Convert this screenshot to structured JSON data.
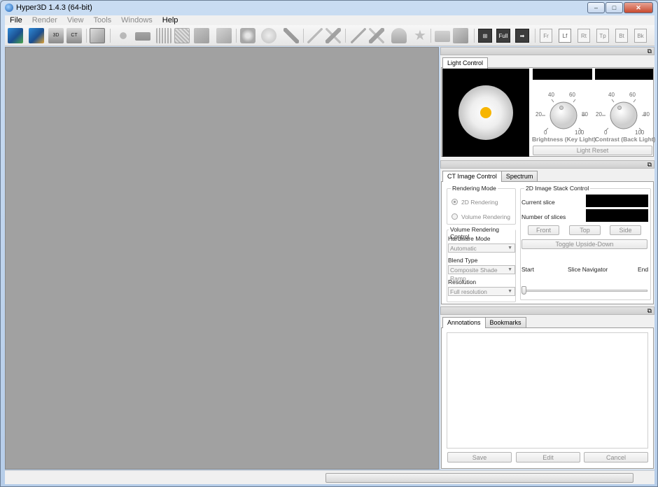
{
  "window": {
    "title": "Hyper3D 1.4.3 (64-bit)",
    "minimize": "–",
    "maximize": "□",
    "close": "✕"
  },
  "menu": {
    "items": [
      {
        "label": "File",
        "enabled": true
      },
      {
        "label": "Render",
        "enabled": false
      },
      {
        "label": "View",
        "enabled": false
      },
      {
        "label": "Tools",
        "enabled": false
      },
      {
        "label": "Windows",
        "enabled": false
      },
      {
        "label": "Help",
        "enabled": true
      }
    ]
  },
  "toolbar": {
    "full_label": "Full",
    "views": [
      "Fr",
      "Lf",
      "Rt",
      "Tp",
      "Bt",
      "Bk"
    ]
  },
  "light_control": {
    "tab": "Light Control",
    "brightness": {
      "caption": "Brightness (Key Light)",
      "ticks": [
        "0",
        "20",
        "40",
        "60",
        "80",
        "100"
      ]
    },
    "contrast": {
      "caption": "Contrast (Back Light)",
      "ticks": [
        "0",
        "20",
        "40",
        "60",
        "80",
        "100"
      ]
    },
    "reset_label": "Light Reset",
    "colors": {
      "sphere_dot": "#f7b500"
    }
  },
  "ct_control": {
    "tabs": [
      "CT Image Control",
      "Spectrum"
    ],
    "rendering_mode": {
      "title": "Rendering Mode",
      "options": [
        "2D Rendering",
        "Volume Rendering"
      ],
      "selected": "2D Rendering"
    },
    "volume_control": {
      "title": "Volume Rendering Control",
      "hardware_label": "Hardware Mode",
      "hardware_value": "Automatic",
      "blend_label": "Blend Type",
      "blend_value": "Composite Shade Ramp",
      "resolution_label": "Resolution",
      "resolution_value": "Full resolution"
    },
    "stack_control": {
      "title": "2D Image Stack Control",
      "current_label": "Current slice",
      "count_label": "Number of slices",
      "front": "Front",
      "top": "Top",
      "side": "Side",
      "toggle": "Toggle Upside-Down",
      "start": "Start",
      "navigator": "Slice Navigator",
      "end": "End"
    }
  },
  "annotations": {
    "tabs": [
      "Annotations",
      "Bookmarks"
    ],
    "save": "Save",
    "edit": "Edit",
    "cancel": "Cancel"
  }
}
